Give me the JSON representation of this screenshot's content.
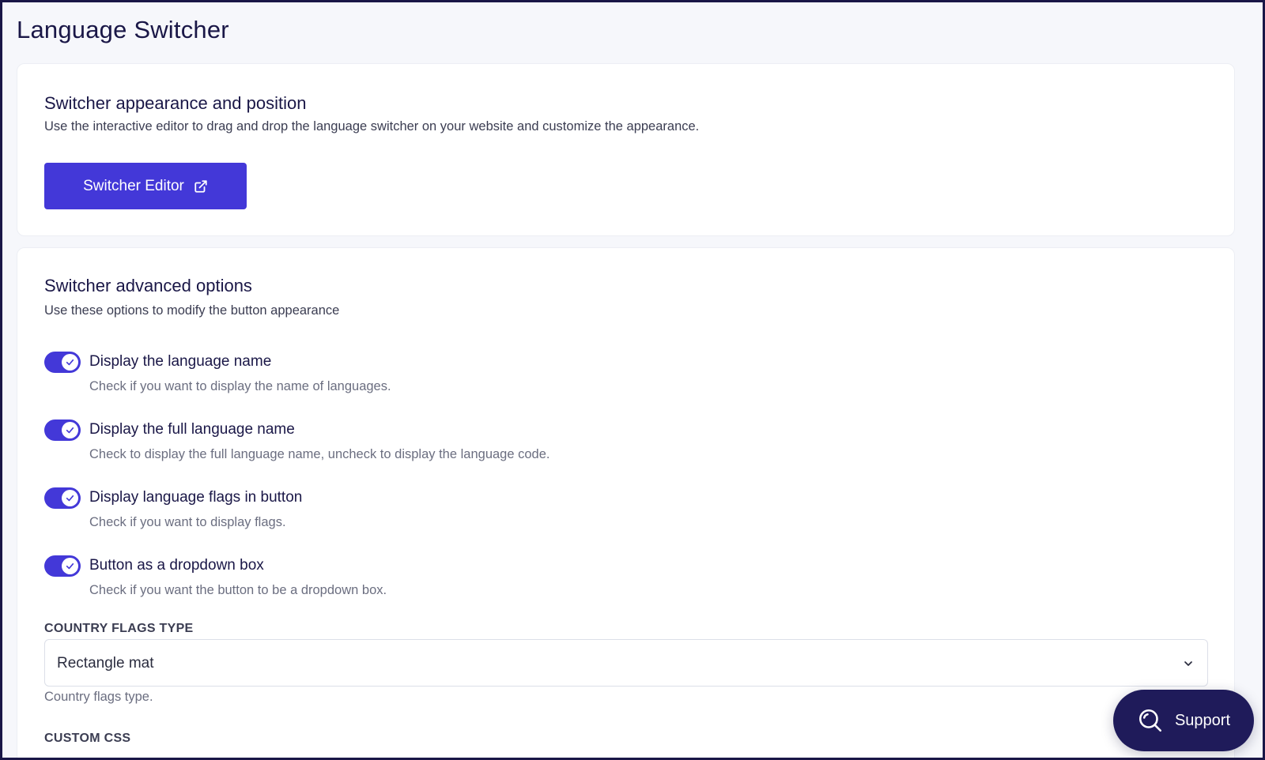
{
  "page": {
    "title": "Language Switcher"
  },
  "appearance": {
    "title": "Switcher appearance and position",
    "description": "Use the interactive editor to drag and drop the language switcher on your website and customize the appearance.",
    "editor_button_label": "Switcher Editor",
    "editor_button_icon": "external-link-icon"
  },
  "advanced": {
    "title": "Switcher advanced options",
    "description": "Use these options to modify the button appearance",
    "options": [
      {
        "label": "Display the language name",
        "help": "Check if you want to display the name of languages.",
        "checked": true
      },
      {
        "label": "Display the full language name",
        "help": "Check to display the full language name, uncheck to display the language code.",
        "checked": true
      },
      {
        "label": "Display language flags in button",
        "help": "Check if you want to display flags.",
        "checked": true
      },
      {
        "label": "Button as a dropdown box",
        "help": "Check if you want the button to be a dropdown box.",
        "checked": true
      }
    ],
    "flags_type": {
      "label": "COUNTRY FLAGS TYPE",
      "value": "Rectangle mat",
      "help": "Country flags type."
    },
    "custom_css": {
      "label": "CUSTOM CSS"
    }
  },
  "support": {
    "label": "Support",
    "icon": "search-icon"
  },
  "colors": {
    "accent": "#4338d8",
    "navy": "#1f1b5a",
    "background": "#f6f7fb"
  }
}
